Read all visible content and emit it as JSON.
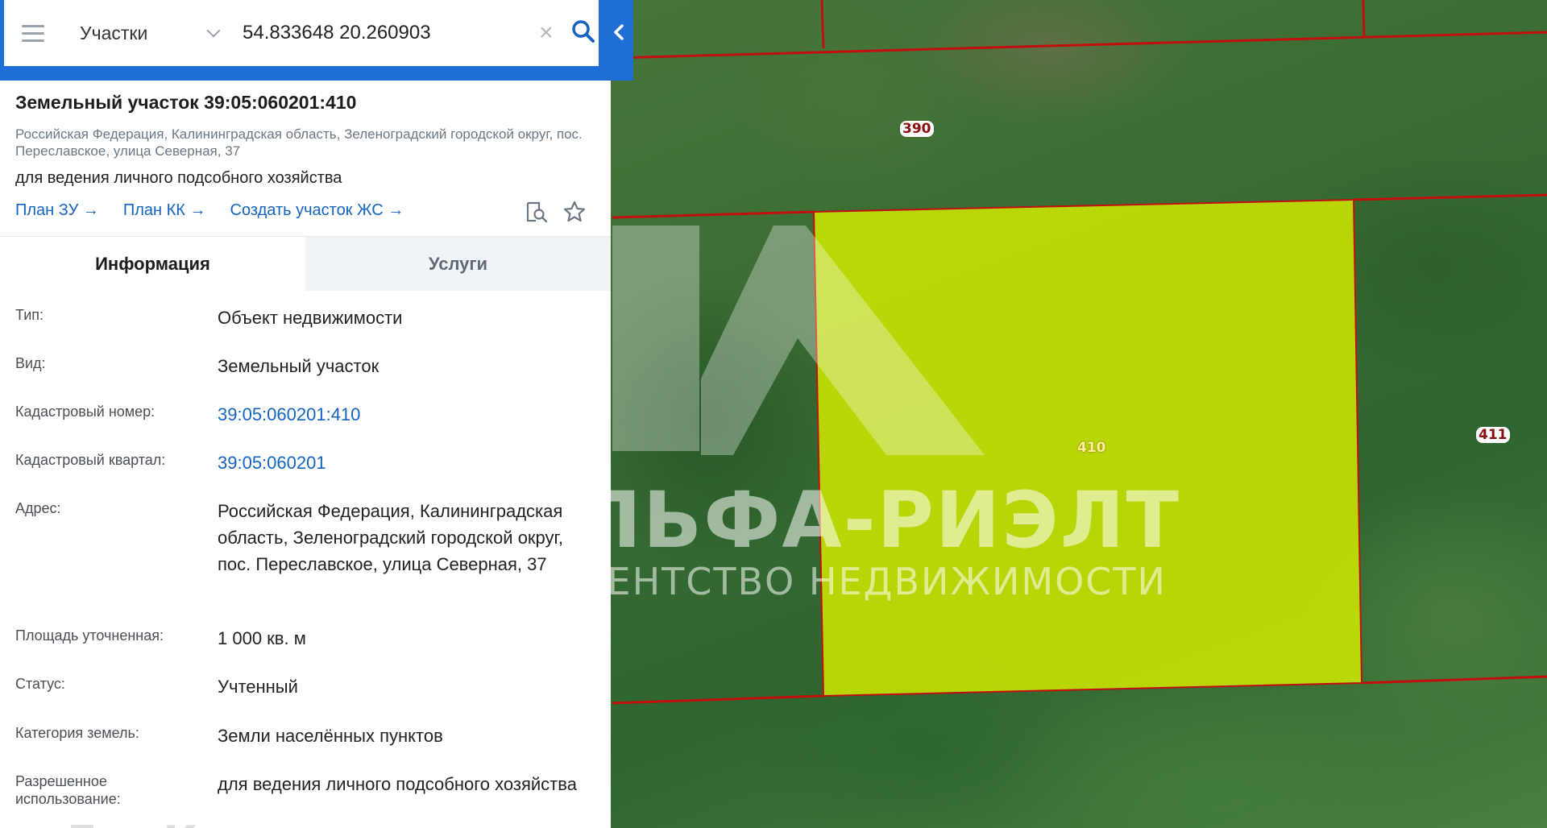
{
  "search": {
    "layer": "Участки",
    "query": "54.833648 20.260903"
  },
  "parcel": {
    "title": "Земельный участок 39:05:060201:410",
    "address_short": "Российская Федерация, Калининградская область, Зеленоградский городской округ, пос. Переславское, улица Северная, 37",
    "purpose": "для ведения личного подсобного хозяйства",
    "links": [
      "План ЗУ →",
      "План КК →",
      "Создать участок ЖС →"
    ]
  },
  "tabs": [
    "Информация",
    "Услуги"
  ],
  "info_rows": [
    {
      "key": "Тип:",
      "value": "Объект недвижимости"
    },
    {
      "key": "Вид:",
      "value": "Земельный участок"
    },
    {
      "key": "Кадастровый номер:",
      "value": "39:05:060201:410"
    },
    {
      "key": "Кадастровый квартал:",
      "value": "39:05:060201"
    },
    {
      "key": "Адрес:",
      "value": "Российская Федерация, Калининградская область, Зеленоградский городской округ, пос. Переславское, улица Северная, 37"
    },
    {
      "key": "Площадь уточненная:",
      "value": "1 000 кв. м"
    },
    {
      "key": "Статус:",
      "value": "Учтенный"
    },
    {
      "key": "Категория земель:",
      "value": "Земли населённых пунктов"
    },
    {
      "key": "Разрешенное использование:",
      "value": "для ведения личного подсобного хозяйства"
    }
  ],
  "map": {
    "parcel_labels": [
      "390",
      "410",
      "411"
    ],
    "highlight_color": "#d7ee00",
    "boundary_color": "#c0100e"
  },
  "watermarks": {
    "brand": "АЛЬФА-РИЭЛТ",
    "tagline": "АГЕНТСТВО НЕДВИЖИМОСТИ",
    "site": "ДомКлик"
  },
  "colors": {
    "accent": "#1d6fd6",
    "link": "#1464c0"
  },
  "icons": [
    "menu-icon",
    "chevron-down-icon",
    "clear-icon",
    "search-icon",
    "collapse-left-icon",
    "zoom-document-icon",
    "star-icon"
  ]
}
